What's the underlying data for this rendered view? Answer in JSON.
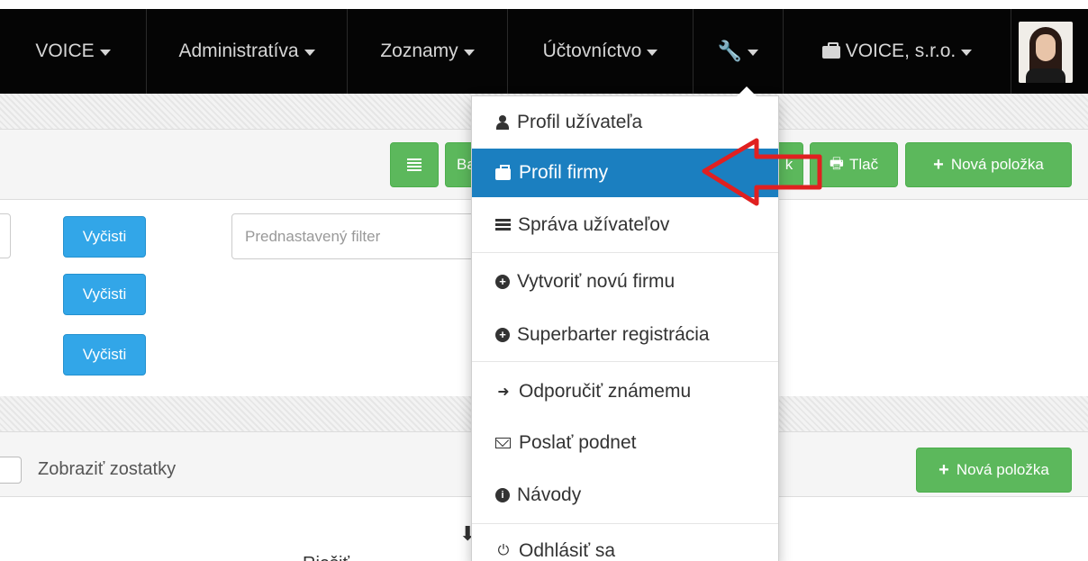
{
  "navbar": {
    "items": [
      {
        "label": "VOICE"
      },
      {
        "label": "Administratíva"
      },
      {
        "label": "Zoznamy"
      },
      {
        "label": "Účtovníctvo"
      }
    ],
    "company": "VOICE, s.r.o."
  },
  "toolbar": {
    "ba_label": "Ba",
    "k_label": "k",
    "print_label": "Tlač",
    "new_item_label": "Nová položka"
  },
  "filters": {
    "clear_label": "Vyčisti",
    "preset_placeholder": "Prednastavený filter"
  },
  "table": {
    "show_balances_label": "Zobraziť zostatky",
    "new_item_label": "Nová položka",
    "partial_header": "Riešiť"
  },
  "dropdown": {
    "items": [
      {
        "label": "Profil užívateľa",
        "icon": "user-icon"
      },
      {
        "label": "Profil firmy",
        "icon": "briefcase-icon",
        "active": true
      },
      {
        "label": "Správa užívateľov",
        "icon": "server-icon"
      },
      {
        "label": "Vytvoriť novú firmu",
        "icon": "plus-circle-icon"
      },
      {
        "label": "Superbarter registrácia",
        "icon": "plus-circle-icon"
      },
      {
        "label": "Odporučiť známemu",
        "icon": "share-arrow-icon"
      },
      {
        "label": "Poslať podnet",
        "icon": "envelope-icon"
      },
      {
        "label": "Návody",
        "icon": "info-circle-icon"
      },
      {
        "label": "Odhlásiť sa",
        "icon": "power-icon"
      }
    ]
  },
  "colors": {
    "navbar": "#050505",
    "active_item": "#1b7fc0",
    "green_button": "#5cb85c",
    "blue_button": "#32a6e8",
    "annotation_arrow": "#e02020"
  }
}
